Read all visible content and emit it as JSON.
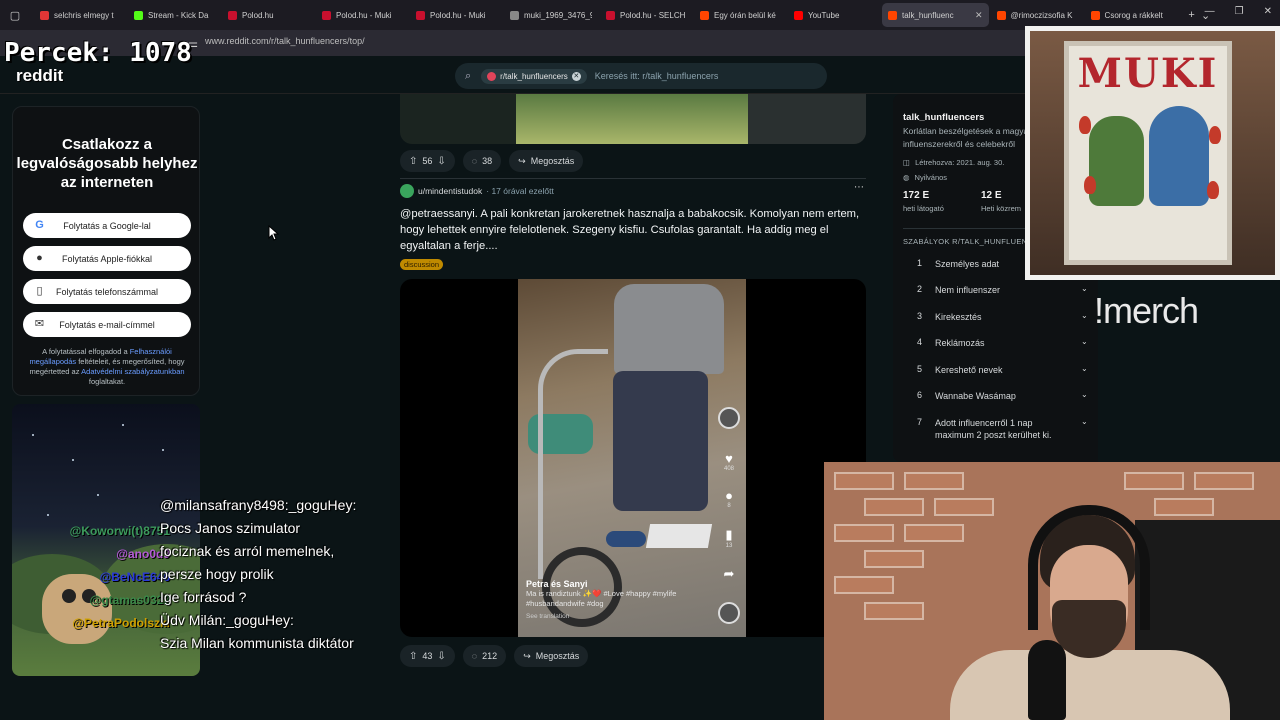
{
  "overlay": {
    "counter": "Percek: 1078",
    "channel": "reddit",
    "merch": "!merch"
  },
  "browser": {
    "tabs": [
      {
        "label": "selchris elmegy t",
        "color": "#e23636"
      },
      {
        "label": "Stream - Kick Da",
        "color": "#53fc18"
      },
      {
        "label": "Polod.hu",
        "color": "#c8102e"
      },
      {
        "label": "Polod.hu - Muki",
        "color": "#c8102e"
      },
      {
        "label": "Polod.hu - Muki",
        "color": "#c8102e"
      },
      {
        "label": "muki_1969_3476_950",
        "color": "#888888"
      },
      {
        "label": "Polod.hu - SELCH",
        "color": "#c8102e"
      },
      {
        "label": "Egy órán belül ké",
        "color": "#ff4500"
      },
      {
        "label": "YouTube",
        "color": "#ff0000"
      },
      {
        "label": "talk_hunfluenc",
        "color": "#ff4500"
      },
      {
        "label": "@rimoczizsofia K",
        "color": "#ff4500"
      },
      {
        "label": "Csorog a rákkelt",
        "color": "#ff4500"
      }
    ],
    "url": "www.reddit.com/r/talk_hunfluencers/top/"
  },
  "search": {
    "chip": "r/talk_hunfluencers",
    "placeholder": "Keresés itt: r/talk_hunfluencers"
  },
  "login": {
    "title": "Csatlakozz a legvalóságosabb helyhez az interneten",
    "google": "Folytatás a Google-lal",
    "apple": "Folytatás Apple-fiókkal",
    "phone": "Folytatás telefonszámmal",
    "email": "Folytatás e-mail-címmel",
    "fine_1": "A folytatással elfogadod a ",
    "fine_link1": "Felhasználói megállapodás",
    "fine_2": " feltételeit, és megerősíted, hogy megértetted az ",
    "fine_link2": "Adatvédelmi szabályzatunkban",
    "fine_3": " foglaltakat."
  },
  "prev_post": {
    "votes": "56",
    "comments": "38",
    "share": "Megosztás"
  },
  "post": {
    "author": "u/mindentistudok",
    "time": "· 17 órával ezelőtt",
    "title": "@petraessanyi. A pali konkretan jarokeretnek hasznalja a babakocsik. Komolyan nem ertem, hogy lehettek ennyire felelotlenek. Szegeny kisfiu. Csufolas garantalt. Ha addig meg el egyaltalan a ferje....",
    "flair": "discussion",
    "votes": "43",
    "comments": "212",
    "share": "Megosztás",
    "video": {
      "name": "Petra és Sanyi",
      "tags": "Ma is randiztunk ✨❤️ #Love #happy #mylife #husbandandwife #dog",
      "translate": "See translation",
      "likes": "408",
      "comment_count": "8",
      "saves": "13"
    }
  },
  "sidebar": {
    "name": "talk_hunfluencers",
    "desc": "Korlátlan beszélgetések a magyar influenszerekről és celebekről",
    "created": "Létrehozva: 2021. aug. 30.",
    "visibility": "Nyilvános",
    "stat1_value": "172 E",
    "stat1_label": "heti látogató",
    "stat2_value": "12 E",
    "stat2_label": "Heti közrem",
    "rules_title": "SZABÁLYOK R/TALK_HUNFLUENC",
    "rules": [
      {
        "n": "1",
        "t": "Személyes adat"
      },
      {
        "n": "2",
        "t": "Nem influenszer"
      },
      {
        "n": "3",
        "t": "Kirekesztés"
      },
      {
        "n": "4",
        "t": "Reklámozás"
      },
      {
        "n": "5",
        "t": "Kereshető nevek"
      },
      {
        "n": "6",
        "t": "Wannabe Wasámap"
      },
      {
        "n": "7",
        "t": "Adott influencerről 1 nap maximum 2 poszt kerülhet ki."
      }
    ]
  },
  "chat": {
    "lines": [
      "@milansafrany8498:_goguHey:",
      "Pocs Janos szimulator",
      "fociznak és arról memelnek,",
      "persze hogy prolik",
      "Ige forrásod ?",
      "Üdv Milán:_goguHey:",
      "Szia Milan kommunista diktátor"
    ],
    "names": [
      {
        "t": "@Koworwi(t)8751",
        "c": "#3c9a5c"
      },
      {
        "t": "@ano0d9",
        "c": "#b45ad6"
      },
      {
        "t": "@BeNcE646",
        "c": "#2b3bd6"
      },
      {
        "t": "@gtamas0322",
        "c": "#3b8a4a"
      },
      {
        "t": "@PetraPodolszki",
        "c": "#d0a000"
      }
    ]
  },
  "poster": {
    "title": "MUKI"
  }
}
